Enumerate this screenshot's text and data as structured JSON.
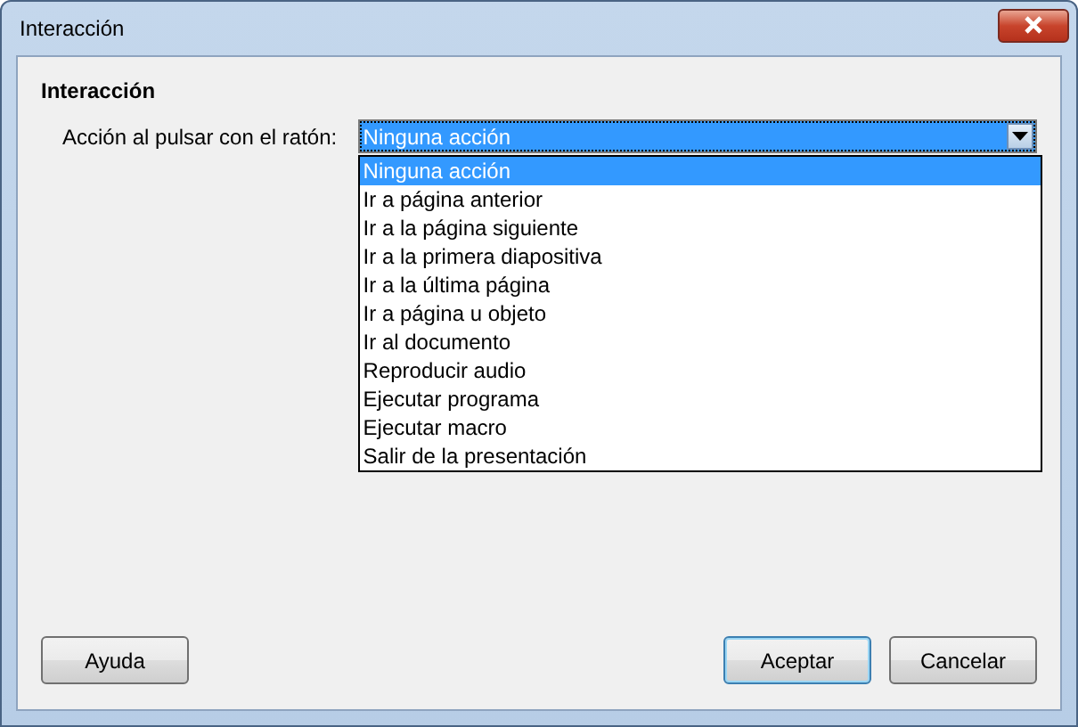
{
  "window": {
    "title": "Interacción"
  },
  "section": {
    "heading": "Interacción"
  },
  "field": {
    "label": "Acción al pulsar con el ratón:",
    "value": "Ninguna acción",
    "expanded": true
  },
  "options": [
    {
      "label": "Ninguna acción",
      "selected": true
    },
    {
      "label": "Ir a página anterior",
      "selected": false
    },
    {
      "label": "Ir a la página siguiente",
      "selected": false
    },
    {
      "label": "Ir a la primera diapositiva",
      "selected": false
    },
    {
      "label": "Ir a la última página",
      "selected": false
    },
    {
      "label": "Ir a página u objeto",
      "selected": false
    },
    {
      "label": "Ir al documento",
      "selected": false
    },
    {
      "label": "Reproducir audio",
      "selected": false
    },
    {
      "label": "Ejecutar programa",
      "selected": false
    },
    {
      "label": "Ejecutar macro",
      "selected": false
    },
    {
      "label": "Salir de la presentación",
      "selected": false
    }
  ],
  "buttons": [
    {
      "label": "Ayuda",
      "default": false
    },
    {
      "label": "Aceptar",
      "default": true
    },
    {
      "label": "Cancelar",
      "default": false
    }
  ]
}
